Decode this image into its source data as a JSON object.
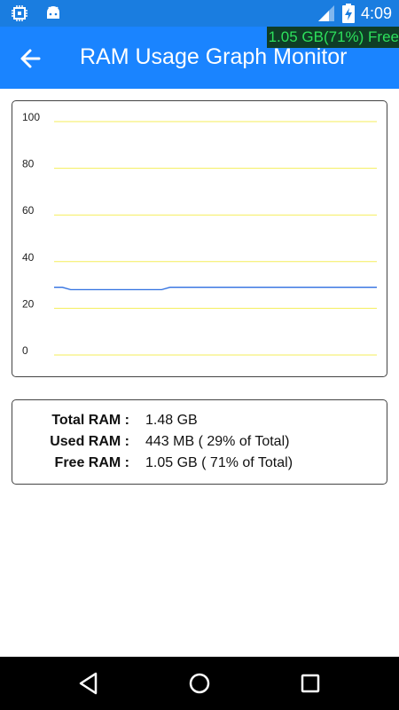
{
  "status_bar": {
    "time": "4:09",
    "icons": [
      "chip-icon",
      "android-icon",
      "signal-icon",
      "battery-charging-icon"
    ]
  },
  "overlay": {
    "free_text": "1.05 GB(71%) Free"
  },
  "app_bar": {
    "title": "RAM Usage Graph Monitor",
    "back_icon": "back-arrow-icon"
  },
  "chart_data": {
    "type": "line",
    "title": "",
    "xlabel": "",
    "ylabel": "",
    "ylim": [
      0,
      100
    ],
    "yticks": [
      "100",
      "80",
      "60",
      "40",
      "20",
      "0"
    ],
    "grid_color": "#f5ee5a",
    "line_color": "#2e6fe0",
    "series": [
      {
        "values": [
          29,
          29,
          28,
          28,
          28,
          28,
          28,
          28,
          28,
          28,
          28,
          28,
          28,
          28,
          29,
          29,
          29,
          29,
          29,
          29,
          29,
          29,
          29,
          29,
          29,
          29,
          29,
          29,
          29,
          29,
          29,
          29,
          29,
          29,
          29,
          29,
          29,
          29,
          29,
          29
        ]
      }
    ]
  },
  "stats": {
    "rows": [
      {
        "label": "Total RAM :",
        "value": "1.48 GB"
      },
      {
        "label": "Used RAM :",
        "value": "443 MB ( 29% of Total)"
      },
      {
        "label": "Free RAM :",
        "value": "1.05 GB ( 71% of Total)"
      }
    ]
  },
  "nav_bar": {
    "buttons": [
      "back-triangle-icon",
      "home-circle-icon",
      "recents-square-icon"
    ]
  }
}
